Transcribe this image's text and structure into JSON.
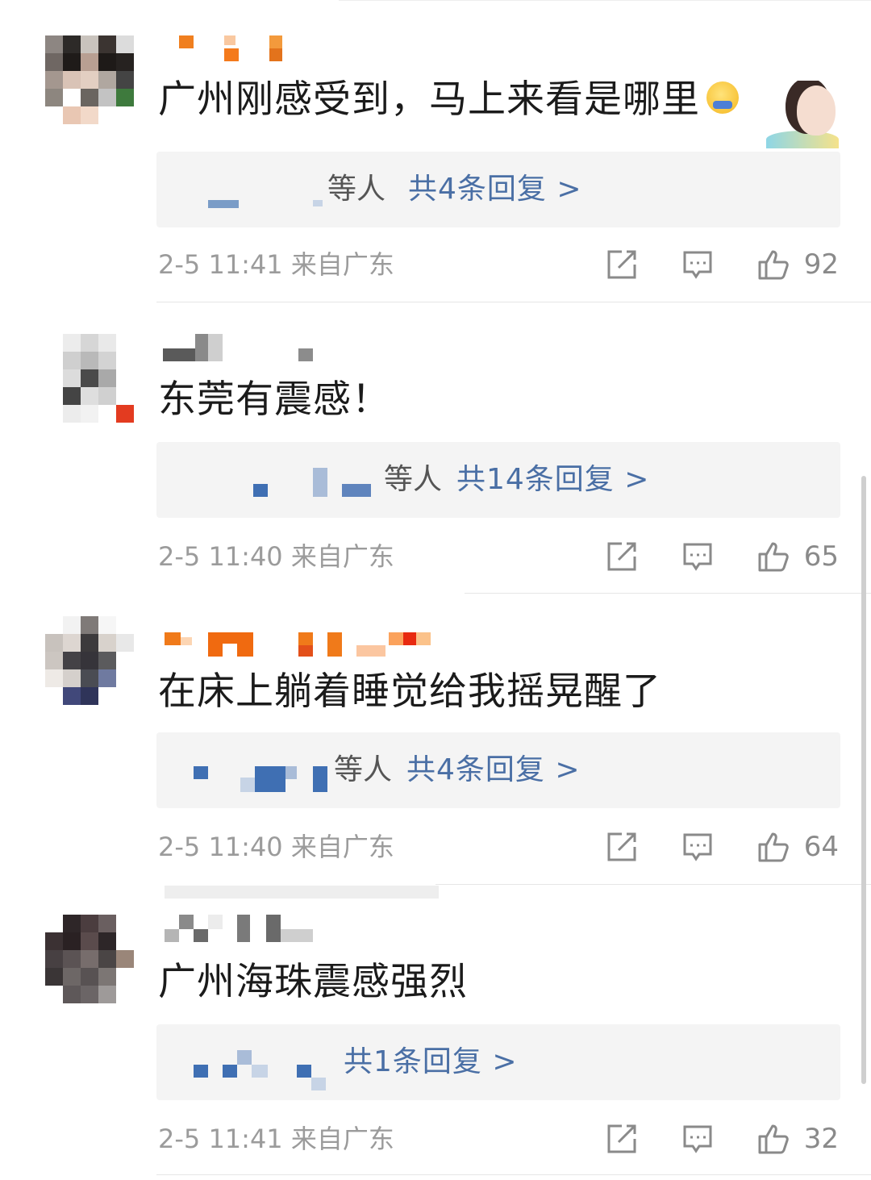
{
  "comments": [
    {
      "text": "广州刚感受到，马上来看是哪里",
      "reply_suffix": "等人",
      "reply_count": "共4条回复 >",
      "time": "2-5 11:41",
      "location": "来自广东",
      "likes": "92"
    },
    {
      "text": "东莞有震感！",
      "reply_suffix": "等人",
      "reply_count": "共14条回复 >",
      "time": "2-5 11:40",
      "location": "来自广东",
      "likes": "65"
    },
    {
      "text": "在床上躺着睡觉给我摇晃醒了",
      "reply_suffix": "等人",
      "reply_count": "共4条回复 >",
      "time": "2-5 11:40",
      "location": "来自广东",
      "likes": "64"
    },
    {
      "text": "广州海珠震感强烈",
      "reply_suffix": "",
      "reply_count": "共1条回复 >",
      "time": "2-5 11:41",
      "location": "来自广东",
      "likes": "32"
    }
  ],
  "icons": {
    "share": "share-icon",
    "comment": "comment-icon",
    "like": "thumbs-up-icon",
    "emoji": "worried-face-emoji-icon"
  },
  "colors": {
    "reply_link": "#4a6fa5",
    "meta_gray": "#9b9b9b",
    "reply_bg": "#f4f4f4"
  }
}
